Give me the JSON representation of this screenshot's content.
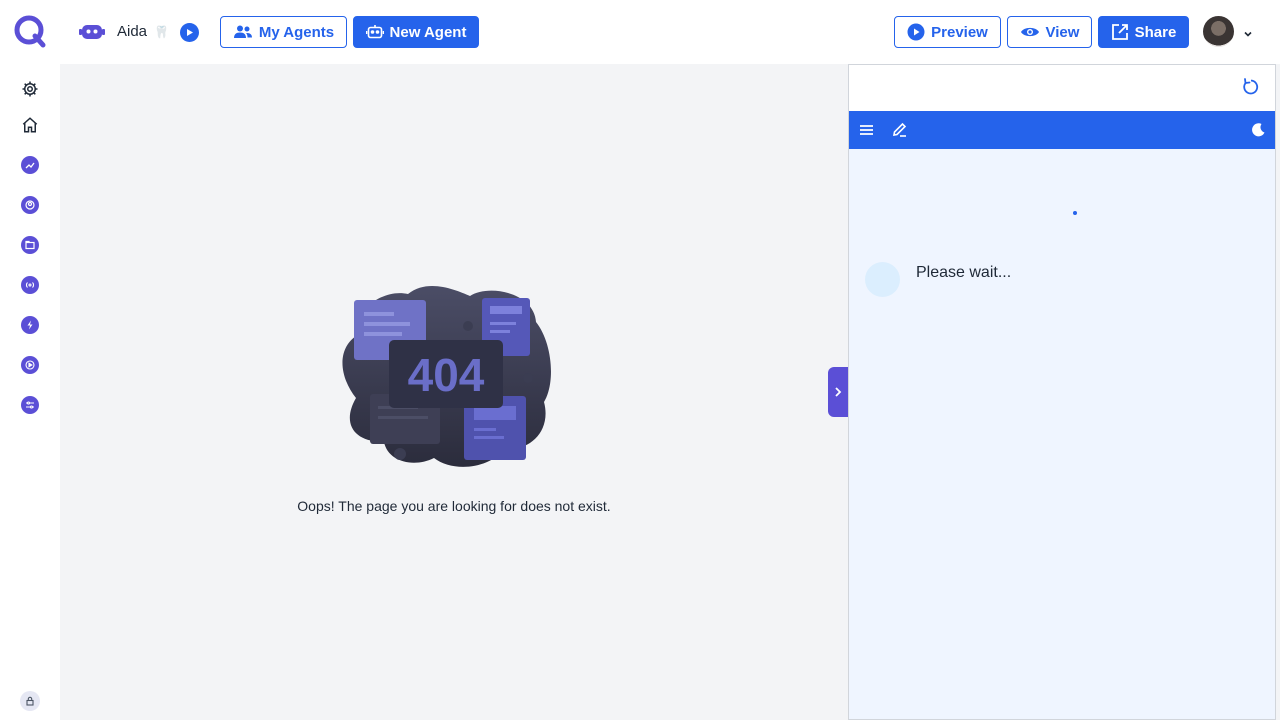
{
  "header": {
    "agent_name": "Aida",
    "agent_emoji": "🦷",
    "my_agents_label": "My Agents",
    "new_agent_label": "New Agent",
    "preview_label": "Preview",
    "view_label": "View",
    "share_label": "Share"
  },
  "sidebar": {
    "items": [
      {
        "icon": "gear-icon"
      },
      {
        "icon": "home-icon"
      },
      {
        "icon": "analytics-icon"
      },
      {
        "icon": "user-icon"
      },
      {
        "icon": "folder-icon"
      },
      {
        "icon": "broadcast-icon"
      },
      {
        "icon": "bolt-icon"
      },
      {
        "icon": "play-icon"
      },
      {
        "icon": "settings-sliders-icon"
      }
    ],
    "bottom_icon": "lock-icon"
  },
  "main": {
    "error_code": "404",
    "message": "Oops! The page you are looking for does not exist."
  },
  "chat": {
    "status_text": "Please wait..."
  },
  "colors": {
    "accent": "#2563eb",
    "brand_purple": "#5b4fd6",
    "panel_bg": "#eff5ff"
  }
}
